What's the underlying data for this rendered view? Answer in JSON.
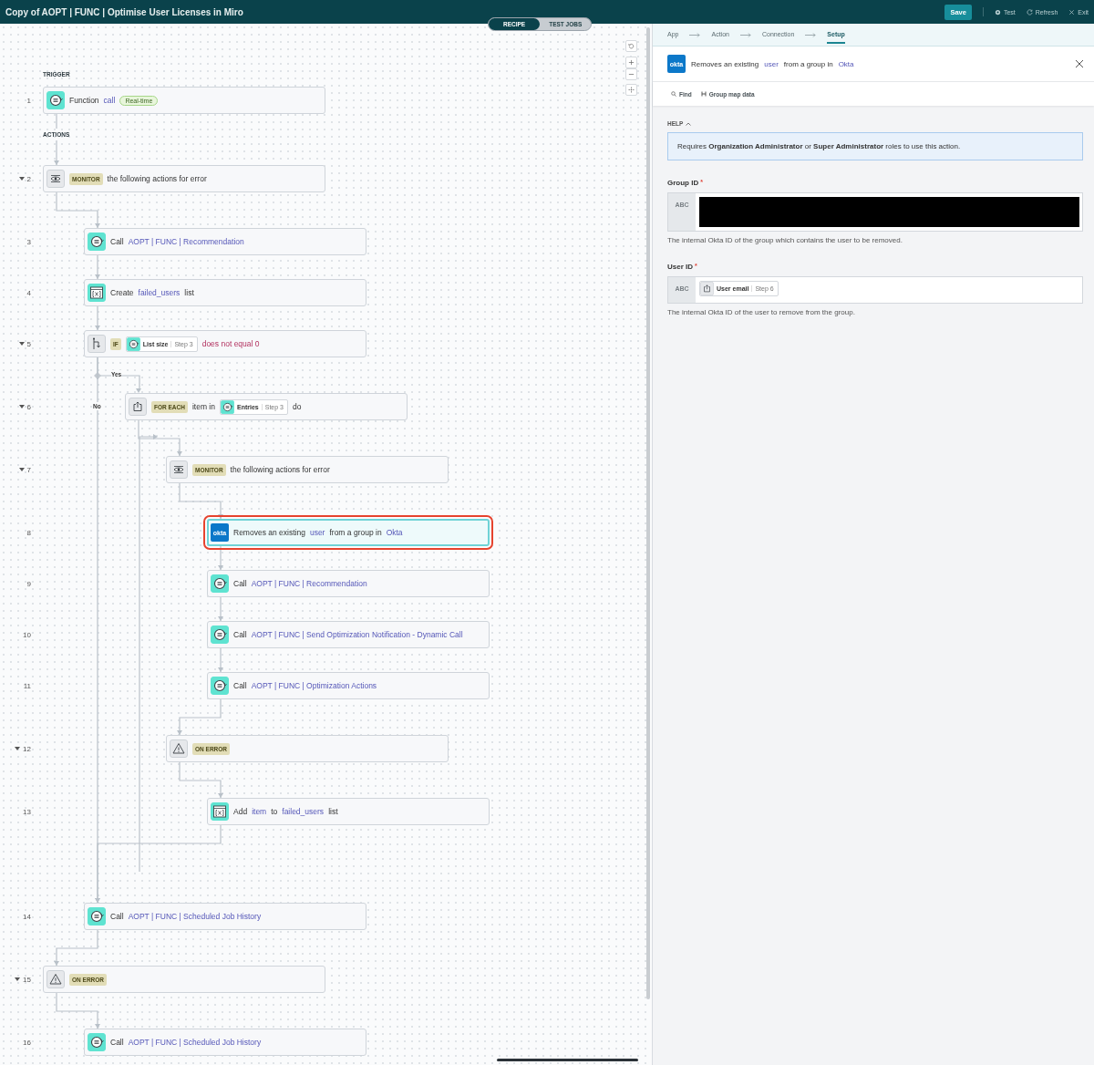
{
  "window": {
    "title": "Copy of AOPT | FUNC | Optimise User Licenses in Miro"
  },
  "toolbar": {
    "save": "Save",
    "actions": [
      {
        "kind": "test",
        "label": "Test"
      },
      {
        "kind": "refresh",
        "label": "Refresh"
      },
      {
        "kind": "exit",
        "label": "Exit"
      }
    ]
  },
  "view_tabs": [
    {
      "label": "RECIPE",
      "selected": true
    },
    {
      "label": "TEST JOBS",
      "selected": false
    }
  ],
  "recipe": {
    "trigger_label": "TRIGGER",
    "actions_label": "ACTIONS",
    "trigger": {
      "number": "1",
      "kind": "function",
      "selected": false,
      "parts": [
        {
          "kind": "text",
          "text": "Function"
        },
        {
          "kind": "link",
          "text": "call"
        },
        {
          "kind": "tag",
          "text": "Real-time"
        }
      ]
    },
    "actions": [
      {
        "number": "2",
        "kind": "monitor",
        "expanded": true,
        "selected": false,
        "parts": [
          {
            "kind": "keyword",
            "text": "MONITOR"
          },
          {
            "kind": "text",
            "text": "the following actions for error"
          }
        ],
        "children": [
          {
            "number": "3",
            "kind": "function",
            "selected": false,
            "parts": [
              {
                "kind": "text",
                "text": "Call"
              },
              {
                "kind": "link",
                "text": "AOPT | FUNC | Recommendation"
              }
            ]
          },
          {
            "number": "4",
            "kind": "variable",
            "selected": false,
            "parts": [
              {
                "kind": "text",
                "text": "Create"
              },
              {
                "kind": "link",
                "text": "failed_users"
              },
              {
                "kind": "text",
                "text": "list"
              }
            ]
          },
          {
            "number": "5",
            "kind": "if",
            "expanded": true,
            "selected": false,
            "yes_label": "Yes",
            "no_label": "No",
            "parts": [
              {
                "kind": "keyword",
                "text": "IF"
              },
              {
                "kind": "pill",
                "text": "List size",
                "step": "Step 3"
              },
              {
                "kind": "condition",
                "text": "does not equal 0"
              }
            ],
            "children": [
              {
                "number": "6",
                "kind": "foreach",
                "expanded": true,
                "selected": false,
                "parts": [
                  {
                    "kind": "keyword",
                    "text": "FOR EACH"
                  },
                  {
                    "kind": "text",
                    "text": "item in"
                  },
                  {
                    "kind": "pill",
                    "text": "Entries",
                    "step": "Step 3"
                  },
                  {
                    "kind": "text",
                    "text": "do"
                  }
                ],
                "children": [
                  {
                    "number": "7",
                    "kind": "monitor",
                    "expanded": true,
                    "selected": false,
                    "parts": [
                      {
                        "kind": "keyword",
                        "text": "MONITOR"
                      },
                      {
                        "kind": "text",
                        "text": "the following actions for error"
                      }
                    ],
                    "children": [
                      {
                        "number": "8",
                        "kind": "app",
                        "logo": "okta",
                        "selected": true,
                        "parts": [
                          {
                            "kind": "text",
                            "text": "Removes an existing"
                          },
                          {
                            "kind": "link",
                            "text": "user"
                          },
                          {
                            "kind": "text",
                            "text": "from a group in"
                          },
                          {
                            "kind": "link",
                            "text": "Okta"
                          }
                        ]
                      },
                      {
                        "number": "9",
                        "kind": "function",
                        "selected": false,
                        "parts": [
                          {
                            "kind": "text",
                            "text": "Call"
                          },
                          {
                            "kind": "link",
                            "text": "AOPT | FUNC | Recommendation"
                          }
                        ]
                      },
                      {
                        "number": "10",
                        "kind": "function",
                        "selected": false,
                        "parts": [
                          {
                            "kind": "text",
                            "text": "Call"
                          },
                          {
                            "kind": "link",
                            "text": "AOPT | FUNC | Send Optimization Notification - Dynamic Call"
                          }
                        ]
                      },
                      {
                        "number": "11",
                        "kind": "function",
                        "selected": false,
                        "parts": [
                          {
                            "kind": "text",
                            "text": "Call"
                          },
                          {
                            "kind": "link",
                            "text": "AOPT | FUNC | Optimization Actions"
                          }
                        ]
                      }
                    ]
                  },
                  {
                    "number": "12",
                    "kind": "on_error",
                    "expanded": true,
                    "selected": false,
                    "parts": [
                      {
                        "kind": "keyword",
                        "text": "ON ERROR"
                      }
                    ],
                    "children": [
                      {
                        "number": "13",
                        "kind": "variable",
                        "selected": false,
                        "parts": [
                          {
                            "kind": "text",
                            "text": "Add"
                          },
                          {
                            "kind": "link",
                            "text": "item"
                          },
                          {
                            "kind": "text",
                            "text": "to"
                          },
                          {
                            "kind": "link",
                            "text": "failed_users"
                          },
                          {
                            "kind": "text",
                            "text": "list"
                          }
                        ]
                      }
                    ]
                  }
                ]
              }
            ]
          },
          {
            "number": "14",
            "kind": "function",
            "selected": false,
            "parts": [
              {
                "kind": "text",
                "text": "Call"
              },
              {
                "kind": "link",
                "text": "AOPT | FUNC | Scheduled Job History"
              }
            ]
          }
        ]
      },
      {
        "number": "15",
        "kind": "on_error",
        "expanded": true,
        "selected": false,
        "parts": [
          {
            "kind": "keyword",
            "text": "ON ERROR"
          }
        ],
        "children": [
          {
            "number": "16",
            "kind": "function",
            "selected": false,
            "parts": [
              {
                "kind": "text",
                "text": "Call"
              },
              {
                "kind": "link",
                "text": "AOPT | FUNC | Scheduled Job History"
              }
            ]
          }
        ]
      }
    ]
  },
  "editor": {
    "steps": [
      {
        "label": "App",
        "selected": false
      },
      {
        "label": "Action",
        "selected": false
      },
      {
        "label": "Connection",
        "selected": false
      },
      {
        "label": "Setup",
        "selected": true
      }
    ],
    "header": {
      "logo": "okta",
      "parts": [
        {
          "kind": "text",
          "text": "Removes an existing"
        },
        {
          "kind": "link",
          "text": "user"
        },
        {
          "kind": "text",
          "text": "from a group in"
        },
        {
          "kind": "link",
          "text": "Okta"
        }
      ]
    },
    "tools": [
      {
        "kind": "find",
        "label": "Find"
      },
      {
        "kind": "group",
        "label": "Group map data"
      }
    ],
    "help": {
      "label": "HELP",
      "expanded": true,
      "text": "Requires **Organization Administrator** or **Super Administrator** roles to use this action."
    },
    "fields": [
      {
        "label": "Group ID",
        "required_mark": "*",
        "type": "ABC",
        "redacted": true,
        "hint": "The internal Okta ID of the group which contains the user to be removed."
      },
      {
        "label": "User ID",
        "required_mark": "*",
        "type": "ABC",
        "pills": [
          {
            "text": "User email",
            "step": "Step 6"
          }
        ],
        "hint": "The internal Okta ID of the user to remove from the group."
      }
    ]
  }
}
